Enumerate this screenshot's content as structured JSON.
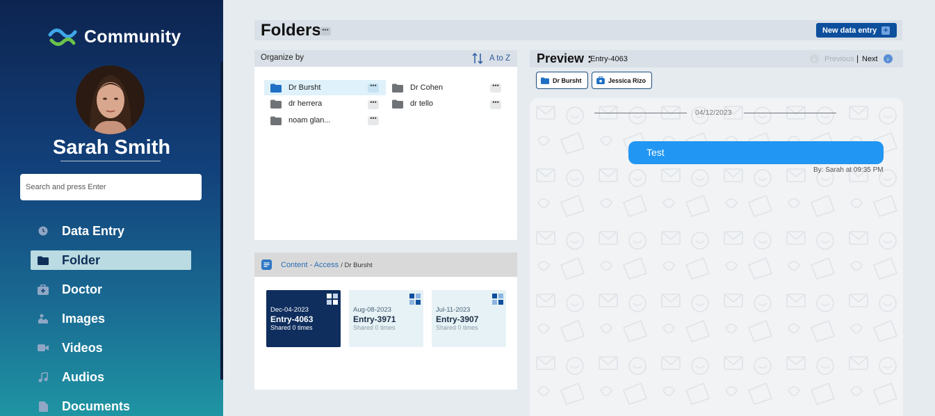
{
  "app": {
    "name": "Community"
  },
  "user": {
    "name": "Sarah Smith"
  },
  "search": {
    "placeholder": "Search and press Enter"
  },
  "nav": [
    {
      "label": "Data Entry",
      "icon": "clock-icon",
      "active": false
    },
    {
      "label": "Folder",
      "icon": "folder-icon",
      "active": true
    },
    {
      "label": "Doctor",
      "icon": "medical-kit-icon",
      "active": false
    },
    {
      "label": "Images",
      "icon": "image-icon",
      "active": false
    },
    {
      "label": "Videos",
      "icon": "video-camera-icon",
      "active": false
    },
    {
      "label": "Audios",
      "icon": "music-note-icon",
      "active": false
    },
    {
      "label": "Documents",
      "icon": "document-icon",
      "active": false
    }
  ],
  "header": {
    "title": "Folders",
    "new_button": "New data entry"
  },
  "organize": {
    "label": "Organize by",
    "sort_label": "A to Z"
  },
  "folders": [
    {
      "name": "Dr Bursht",
      "active": true
    },
    {
      "name": "Dr Cohen",
      "active": false
    },
    {
      "name": "dr herrera",
      "active": false
    },
    {
      "name": "dr tello",
      "active": false
    },
    {
      "name": "noam glan...",
      "active": false
    }
  ],
  "content": {
    "crumb": "Content - Access",
    "sub": "/ Dr Bursht"
  },
  "entries": [
    {
      "date": "Dec-04-2023",
      "title": "Entry-4063",
      "shared": "Shared 0 times",
      "active": true
    },
    {
      "date": "Aug-08-2023",
      "title": "Entry-3971",
      "shared": "Shared 0 times",
      "active": false
    },
    {
      "date": "Jul-11-2023",
      "title": "Entry-3907",
      "shared": "Shared 0 times",
      "active": false
    }
  ],
  "preview": {
    "title": "Preview :",
    "entry": "Entry-4063",
    "previous": "Previous",
    "separator": "|",
    "next": "Next",
    "tags": [
      "Dr Bursht",
      "Jessica Rizo"
    ]
  },
  "chat": {
    "date": "04/12/2023",
    "message": "Test",
    "meta": "By: Sarah at 09:35 PM"
  },
  "colors": {
    "accent": "#0d4f9d",
    "bubble": "#2196f3",
    "active_card": "#0f2e5e"
  }
}
